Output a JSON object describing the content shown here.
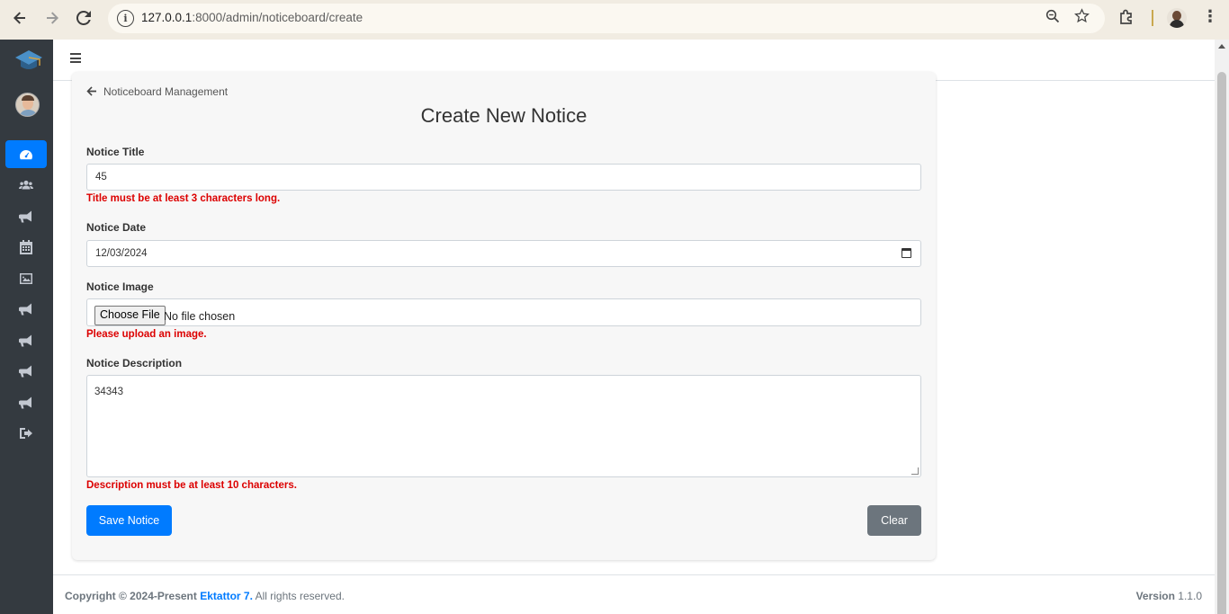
{
  "browser": {
    "url_host": "127.0.0.1",
    "url_rest": ":8000/admin/noticeboard/create"
  },
  "sidebar": {
    "items": [
      {
        "icon": "dashboard-icon",
        "active": true
      },
      {
        "icon": "users-icon"
      },
      {
        "icon": "megaphone-icon"
      },
      {
        "icon": "calendar-icon"
      },
      {
        "icon": "image-icon"
      },
      {
        "icon": "megaphone-icon"
      },
      {
        "icon": "megaphone-icon"
      },
      {
        "icon": "megaphone-icon"
      },
      {
        "icon": "megaphone-icon"
      },
      {
        "icon": "logout-icon"
      }
    ],
    "active_color": "#007bff",
    "bg_color": "#343a40"
  },
  "page": {
    "breadcrumb": "Noticeboard Management",
    "title": "Create New Notice"
  },
  "form": {
    "title_label": "Notice Title",
    "title_value": "45",
    "title_error": "Title must be at least 3 characters long.",
    "date_label": "Notice Date",
    "date_value": "12/03/2024",
    "image_label": "Notice Image",
    "choose_file_label": "Choose File",
    "no_file_text": "No file chosen",
    "image_error": "Please upload an image.",
    "description_label": "Notice Description",
    "description_value": "34343",
    "description_error": "Description must be at least 10 characters.",
    "save_label": "Save Notice",
    "clear_label": "Clear",
    "error_color": "#dc0000"
  },
  "footer": {
    "copyright_prefix": "Copyright © 2024-Present",
    "brand": "Ektattor 7.",
    "rights": "All rights reserved.",
    "version_label": "Version",
    "version_value": "1.1.0"
  }
}
